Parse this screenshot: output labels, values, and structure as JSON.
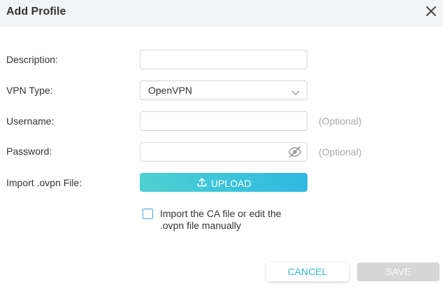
{
  "dialog": {
    "title": "Add Profile",
    "close_icon": "close-icon"
  },
  "form": {
    "description": {
      "label": "Description:",
      "value": ""
    },
    "vpn_type": {
      "label": "VPN Type:",
      "value": "OpenVPN",
      "icon": "chevron-down-icon"
    },
    "username": {
      "label": "Username:",
      "value": "",
      "hint": "(Optional)"
    },
    "password": {
      "label": "Password:",
      "value": "",
      "hint": "(Optional)",
      "icon": "eye-slash-icon"
    },
    "import_file": {
      "label": "Import .ovpn File:",
      "button_label": "UPLOAD",
      "icon": "upload-icon"
    },
    "manual_edit": {
      "label": "Import the CA file or edit the .ovpn file manually",
      "checked": false
    }
  },
  "actions": {
    "cancel_label": "CANCEL",
    "save_label": "SAVE"
  },
  "colors": {
    "accent": "#35b8d6",
    "header_bg": "#f3f4f6",
    "disabled": "#d6d6d6"
  }
}
